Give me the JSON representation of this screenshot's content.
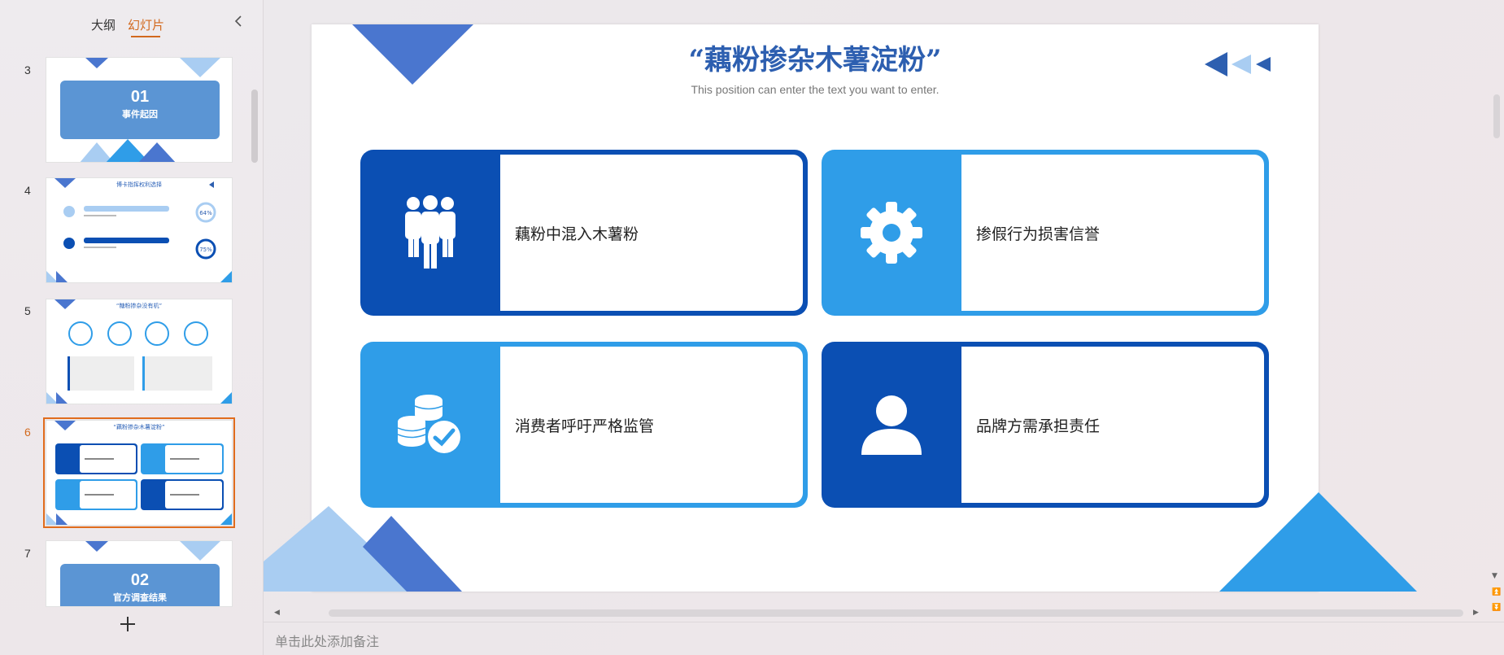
{
  "left_panel": {
    "tabs": [
      {
        "label": "大纲",
        "active": false
      },
      {
        "label": "幻灯片",
        "active": true
      }
    ],
    "collapse_icon": "chevron-left-icon",
    "add_slide_icon": "plus-icon",
    "thumbnails": [
      {
        "number": "3",
        "kind": "section",
        "section_num": "01",
        "section_title": "事件起因"
      },
      {
        "number": "4",
        "kind": "progress",
        "title": "博卡指挥权利选择",
        "percent_a": "64%",
        "percent_b": "75%"
      },
      {
        "number": "5",
        "kind": "icons",
        "title": "“糖粉掺杂没有机”"
      },
      {
        "number": "6",
        "kind": "cards",
        "title": "“藕粉掺杂木薯淀粉”",
        "active": true
      },
      {
        "number": "7",
        "kind": "section",
        "section_num": "02",
        "section_title": "官方调查结果"
      }
    ]
  },
  "slide": {
    "title": "“藕粉掺杂木薯淀粉”",
    "subtitle": "This position can enter the text you want to enter.",
    "cards": [
      {
        "text": "藕粉中混入木薯粉",
        "icon": "people-group-icon",
        "style": "dark"
      },
      {
        "text": "掺假行为损害信誉",
        "icon": "gear-icon",
        "style": "light"
      },
      {
        "text": "消费者呼吁严格监管",
        "icon": "coins-check-icon",
        "style": "light"
      },
      {
        "text": "品牌方需承担责任",
        "icon": "person-icon",
        "style": "dark"
      }
    ]
  },
  "notes": {
    "placeholder": "单击此处添加备注"
  },
  "colors": {
    "accent": "#d2691e",
    "dark_blue": "#0b4fb3",
    "light_blue": "#2f9de8",
    "title_blue": "#2d5fb0"
  }
}
